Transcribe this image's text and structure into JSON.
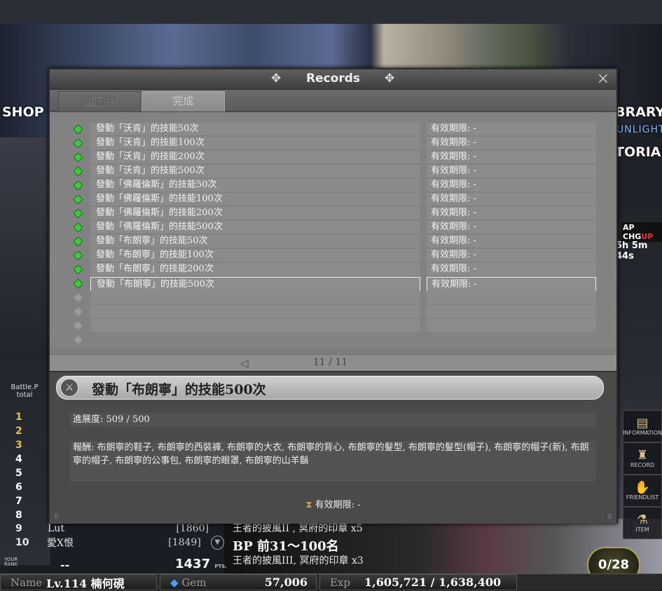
{
  "nav": {
    "shop": "SHOP",
    "library": "BRARY",
    "unlight": "UNLIGHT",
    "tutorial": "TORIAL",
    "apchg": "AP CHG",
    "apchg_up": "UP",
    "ap_timer": "5h 5m 44s"
  },
  "side_icons": [
    {
      "label": "information",
      "icon": "document-icon",
      "glyph": "▤"
    },
    {
      "label": "record",
      "icon": "trophy-icon",
      "glyph": "♜"
    },
    {
      "label": "friendlist",
      "icon": "handshake-icon",
      "glyph": "✋"
    },
    {
      "label": "item",
      "icon": "flask-icon",
      "glyph": "⚗"
    }
  ],
  "ranking": {
    "header_line1": "Battle.P",
    "header_line2": "total",
    "numbers": [
      "1",
      "2",
      "3",
      "4",
      "5",
      "6",
      "7",
      "8"
    ],
    "rows": [
      {
        "rank": "9",
        "name": "Lut",
        "score": "[1860]"
      },
      {
        "rank": "10",
        "name": "愛X恨",
        "score": "[1849]"
      }
    ],
    "your_rank_label": "YOUR RANK",
    "your_rank_value": "--",
    "points": "1437",
    "points_unit": "PTS."
  },
  "reward_info": {
    "line1": "王者的披風II , 冥府的印章 x5",
    "line2": "BP 前31～100名",
    "line3": "王者的披風III, 冥府的印章 x3"
  },
  "badge": {
    "value": "0/28",
    "stars": "★★★"
  },
  "statusbar": {
    "name_label": "Name",
    "name_value": "Lv.114 楠何硯",
    "gem_label": "Gem",
    "gem_value": "57,006",
    "exp_label": "Exp",
    "exp_value": "1,605,721 / 1,638,400"
  },
  "modal": {
    "title": "Records",
    "close": "×",
    "tabs": [
      {
        "label": "進行中",
        "active": false
      },
      {
        "label": "完成",
        "active": true
      }
    ],
    "records": [
      {
        "name": "發動「沃肯」的技能50次",
        "expiry": "有效期限: -",
        "done": true
      },
      {
        "name": "發動「沃肯」的技能100次",
        "expiry": "有效期限: -",
        "done": true
      },
      {
        "name": "發動「沃肯」的技能200次",
        "expiry": "有效期限: -",
        "done": true
      },
      {
        "name": "發動「沃肯」的技能500次",
        "expiry": "有效期限: -",
        "done": true
      },
      {
        "name": "發動「佛羅倫斯」的技能50次",
        "expiry": "有效期限: -",
        "done": true
      },
      {
        "name": "發動「佛羅倫斯」的技能100次",
        "expiry": "有效期限: -",
        "done": true
      },
      {
        "name": "發動「佛羅倫斯」的技能200次",
        "expiry": "有效期限: -",
        "done": true
      },
      {
        "name": "發動「佛羅倫斯」的技能500次",
        "expiry": "有效期限: -",
        "done": true
      },
      {
        "name": "發動「布朗寧」的技能50次",
        "expiry": "有效期限: -",
        "done": true
      },
      {
        "name": "發動「布朗寧」的技能100次",
        "expiry": "有效期限: -",
        "done": true
      },
      {
        "name": "發動「布朗寧」的技能200次",
        "expiry": "有效期限: -",
        "done": true
      },
      {
        "name": "發動「布朗寧」的技能500次",
        "expiry": "有效期限: -",
        "done": true,
        "selected": true
      },
      {
        "name": "",
        "expiry": "",
        "done": false
      },
      {
        "name": "",
        "expiry": "",
        "done": false
      },
      {
        "name": "",
        "expiry": "",
        "done": false
      },
      {
        "name": "",
        "expiry": "",
        "done": false
      }
    ],
    "pager": {
      "prev": "◁",
      "text": "11 / 11"
    },
    "detail": {
      "title": "發動「布朗寧」的技能500次",
      "progress": "進展度: 509 / 500",
      "reward": "報酬: 布朗寧的鞋子, 布朗寧的西裝褲, 布朗寧的大衣, 布朗寧的背心, 布朗寧的髮型, 布朗寧的髮型(帽子), 布朗寧的帽子(新), 布朗寧的帽子, 布朗寧的公事包, 布朗寧的眼罩, 布朗寧的山羊鬍",
      "expiry": "有效期限: -"
    }
  },
  "colors": {
    "done_icon": "#3ec83e",
    "empty_icon": "#9a9a9a",
    "modal_bg": "#7c7c7c",
    "detail_bg": "#4a4a4a"
  }
}
